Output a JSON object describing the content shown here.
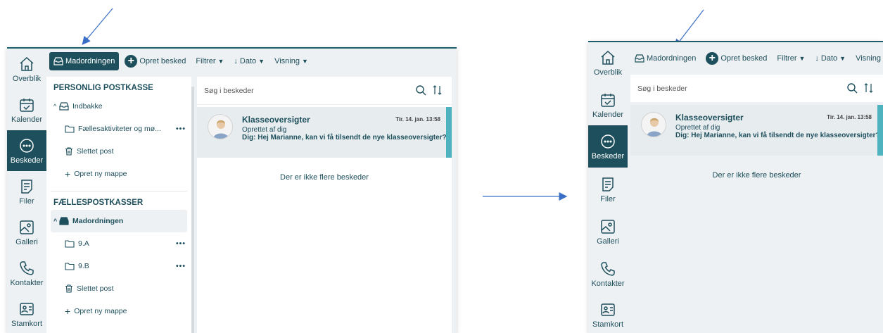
{
  "before": {
    "rail": [
      {
        "label": "Overblik",
        "icon": "home-icon"
      },
      {
        "label": "Kalender",
        "icon": "calendar-icon"
      },
      {
        "label": "Beskeder",
        "icon": "chat-icon",
        "active": true
      },
      {
        "label": "Filer",
        "icon": "file-icon"
      },
      {
        "label": "Galleri",
        "icon": "gallery-icon"
      },
      {
        "label": "Kontakter",
        "icon": "phone-icon"
      },
      {
        "label": "Stamkort",
        "icon": "id-card-icon"
      }
    ],
    "toolbar": {
      "mailbox": "Madordningen",
      "create": "Opret besked",
      "filter": "Filtrer",
      "date": "Dato",
      "view": "Visning"
    },
    "tree": {
      "personal_title": "PERSONLIG POSTKASSE",
      "inbox": "Indbakke",
      "folder_shared": "Fællesaktiviteter og mø...",
      "deleted": "Slettet post",
      "new_folder": "Opret ny mappe",
      "shared_title": "FÆLLESPOSTKASSER",
      "shared_mailbox": "Madordningen",
      "folder_a": "9.A",
      "folder_b": "9.B",
      "deleted2": "Slettet post",
      "new_folder2": "Opret ny mappe"
    },
    "search": {
      "placeholder": "Søg i beskeder"
    },
    "message": {
      "subject": "Klasseoversigter",
      "date": "Tir. 14. jan. 13:58",
      "creator": "Oprettet af dig",
      "preview": "Dig: Hej Marianne, kan vi få tilsendt de nye klasseoversigter?"
    },
    "no_more": "Der er ikke flere beskeder"
  },
  "after": {
    "toolbar": {
      "mailbox": "Madordningen",
      "create": "Opret besked",
      "filter": "Filtrer",
      "date": "Dato",
      "view": "Visning"
    },
    "search": {
      "placeholder": "Søg i beskeder"
    },
    "message": {
      "subject": "Klasseoversigter",
      "date": "Tir. 14. jan. 13:58",
      "creator": "Oprettet af dig",
      "preview": "Dig: Hej Marianne, kan vi få tilsendt de nye klasseoversigter?"
    },
    "no_more": "Der er ikke flere beskeder"
  },
  "colors": {
    "primary": "#1e4f5c",
    "accent": "#4fb3bf",
    "arrow": "#3b6fc7"
  }
}
